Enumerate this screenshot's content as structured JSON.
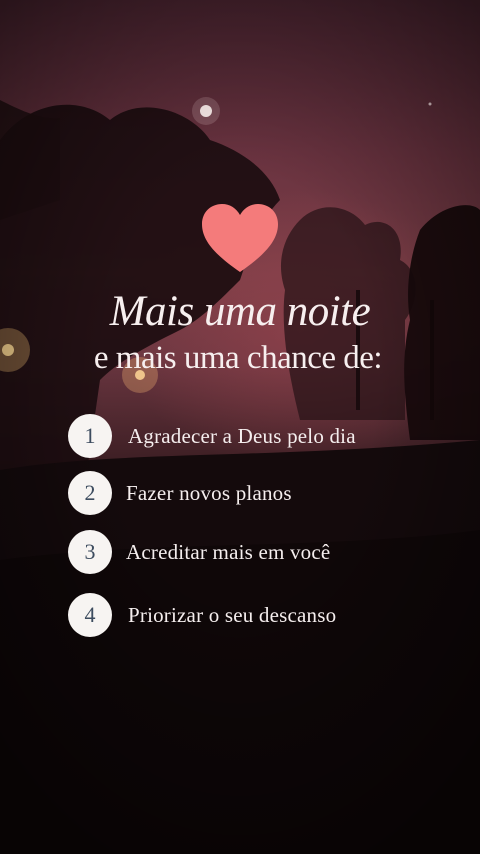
{
  "heading": {
    "title": "Mais uma noite",
    "subtitle": "e mais uma chance de:"
  },
  "list": {
    "items": [
      {
        "number": "1",
        "text": "Agradecer a Deus pelo dia"
      },
      {
        "number": "2",
        "text": "Fazer novos planos"
      },
      {
        "number": "3",
        "text": "Acreditar mais em você"
      },
      {
        "number": "4",
        "text": "Priorizar o seu descanso"
      }
    ]
  },
  "icons": {
    "heart": "heart-icon",
    "moon": "moon-icon"
  },
  "colors": {
    "heart": "#f47b7b",
    "badge_bg": "#f7f4f2",
    "badge_text": "#3d4c5f",
    "text": "#f5eeee"
  }
}
